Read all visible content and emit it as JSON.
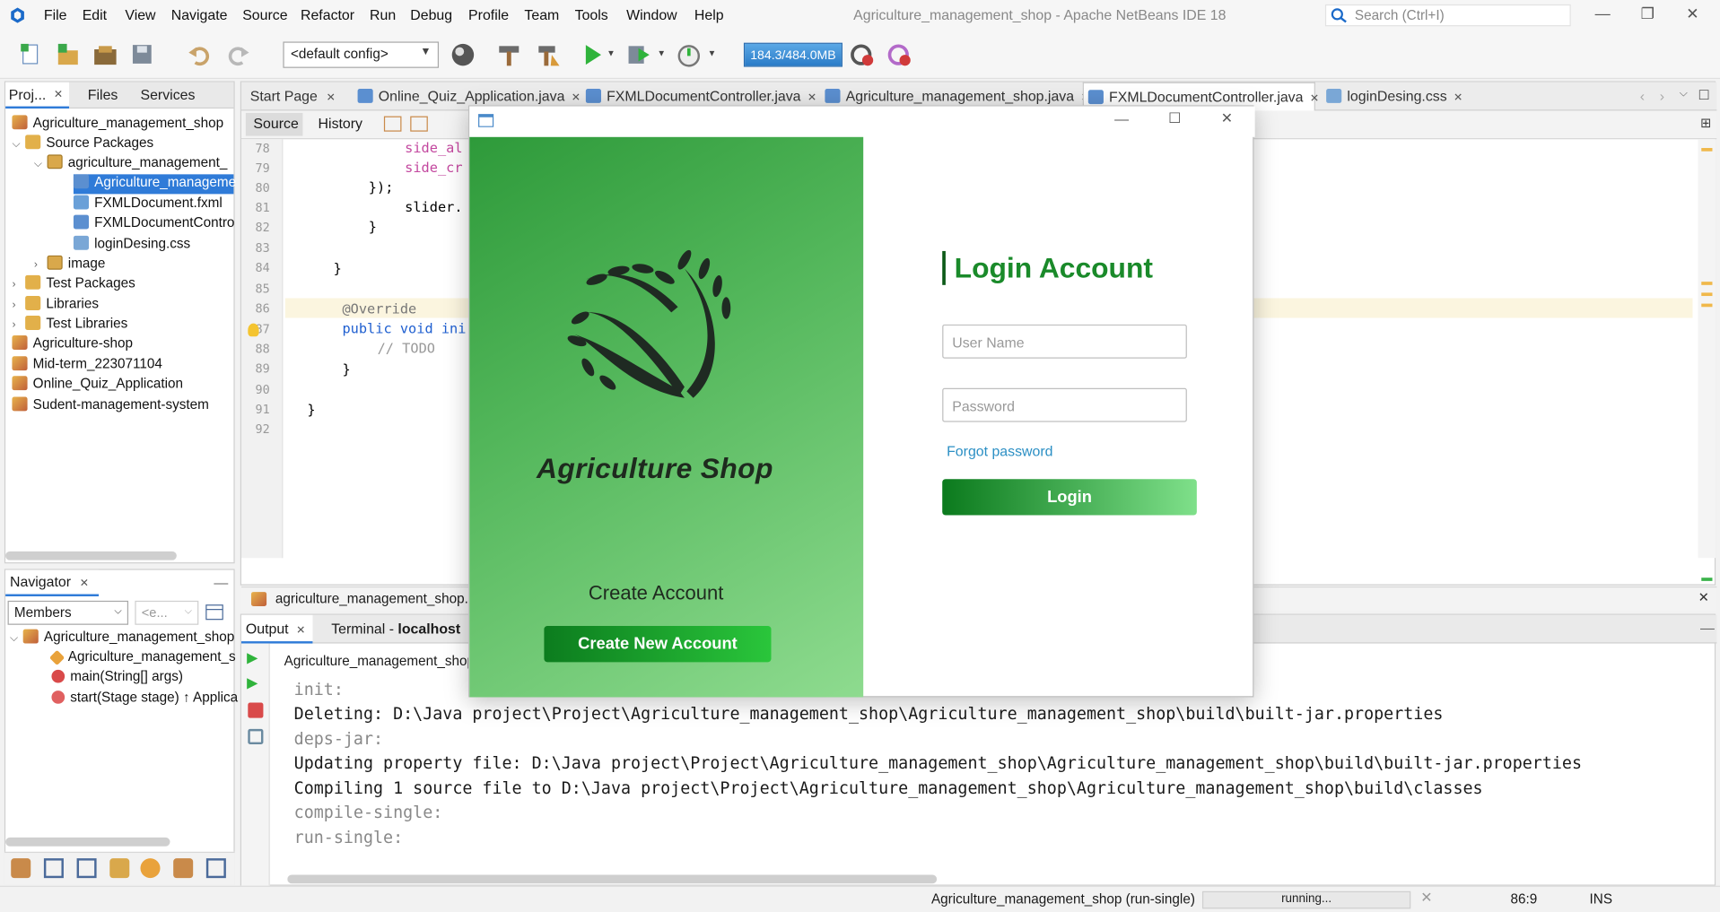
{
  "menu": [
    "File",
    "Edit",
    "View",
    "Navigate",
    "Source",
    "Refactor",
    "Run",
    "Debug",
    "Profile",
    "Team",
    "Tools",
    "Window",
    "Help"
  ],
  "window_title": "Agriculture_management_shop - Apache NetBeans IDE 18",
  "search_placeholder": "Search (Ctrl+I)",
  "toolbar": {
    "config": "<default config>",
    "memory": "184.3/484.0MB"
  },
  "project_tabs": [
    "Proj...",
    "Files",
    "Services"
  ],
  "tree": [
    {
      "label": "Agriculture_management_shop"
    },
    {
      "label": "Source Packages"
    },
    {
      "label": "agriculture_management_"
    },
    {
      "label": "Agriculture_manageme"
    },
    {
      "label": "FXMLDocument.fxml"
    },
    {
      "label": "FXMLDocumentContro"
    },
    {
      "label": "loginDesing.css"
    },
    {
      "label": "image"
    },
    {
      "label": "Test Packages"
    },
    {
      "label": "Libraries"
    },
    {
      "label": "Test Libraries"
    },
    {
      "label": "Agriculture-shop"
    },
    {
      "label": "Mid-term_223071104"
    },
    {
      "label": "Online_Quiz_Application"
    },
    {
      "label": "Sudent-management-system"
    }
  ],
  "navigator": {
    "title": "Navigator",
    "filter": "Members",
    "filter2": "<e...",
    "items": [
      "Agriculture_management_shop",
      "Agriculture_management_s",
      "main(String[] args)",
      "start(Stage stage) ↑ Applica"
    ]
  },
  "editor_tabs": [
    "Start Page",
    "Online_Quiz_Application.java",
    "FXMLDocumentController.java",
    "Agriculture_management_shop.java",
    "FXMLDocumentController.java",
    "loginDesing.css"
  ],
  "editor_views": {
    "source": "Source",
    "history": "History"
  },
  "line_numbers": [
    "78",
    "79",
    "80",
    "81",
    "82",
    "83",
    "84",
    "85",
    "86",
    "87",
    "88",
    "89",
    "90",
    "91",
    "92"
  ],
  "code_lines": [
    "side_al",
    "side_cr",
    "});",
    "slider.",
    "}",
    "",
    "}",
    "",
    "@Override",
    "public void ini",
    "// TODO",
    "}",
    "",
    "}",
    ""
  ],
  "breadcrumb": "agriculture_management_shop.FX",
  "output": {
    "tabs": [
      "Output",
      "Terminal - ",
      "localhost"
    ],
    "header": "Agriculture_management_shop",
    "lines": [
      "init:",
      "Deleting: D:\\Java project\\Project\\Agriculture_management_shop\\Agriculture_management_shop\\build\\built-jar.properties",
      "deps-jar:",
      "Updating property file: D:\\Java project\\Project\\Agriculture_management_shop\\Agriculture_management_shop\\build\\built-jar.properties",
      "Compiling 1 source file to D:\\Java project\\Project\\Agriculture_management_shop\\Agriculture_management_shop\\build\\classes",
      "compile-single:",
      "run-single:"
    ]
  },
  "status": {
    "task": "Agriculture_management_shop (run-single)",
    "progress": "running...",
    "position": "86:9",
    "mode": "INS"
  },
  "login": {
    "brand": "Agriculture Shop",
    "create_label": "Create Account",
    "create_button": "Create New Account",
    "title": "Login Account",
    "username_placeholder": "User Name",
    "password_placeholder": "Password",
    "forgot": "Forgot password",
    "login_button": "Login"
  },
  "colors": {
    "accent": "#1a8a2a",
    "selection": "#2f7bd8",
    "memory_bar": "#3b8fd8"
  }
}
